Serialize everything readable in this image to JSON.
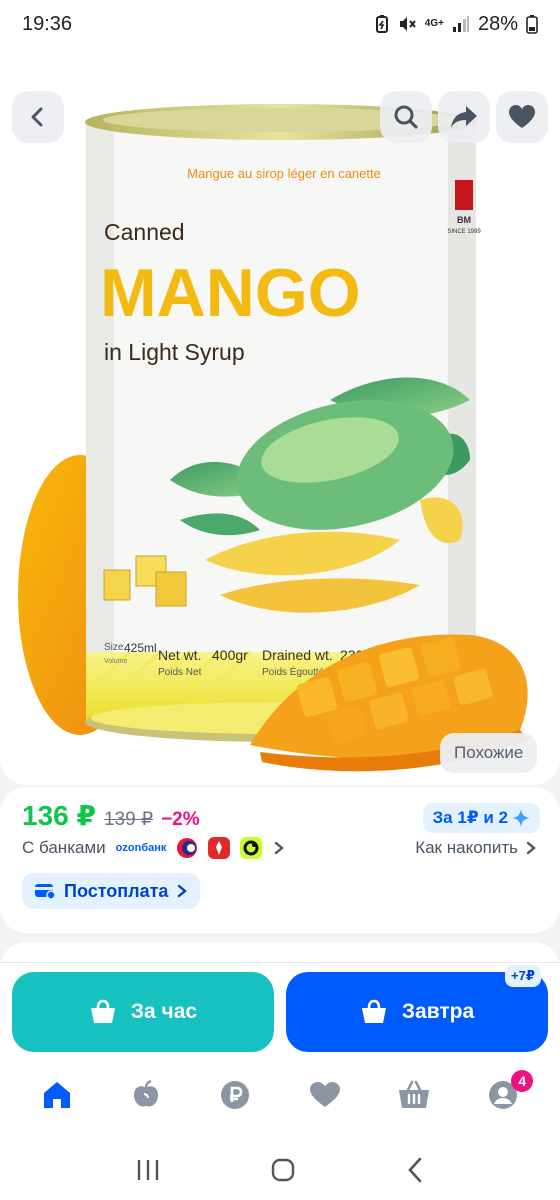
{
  "status_bar": {
    "time": "19:36",
    "network": "4G+",
    "battery": "28%"
  },
  "product_image": {
    "tagline": "Mangue au sirop léger en canette",
    "canned": "Canned",
    "mango": "MANGO",
    "syrup": "in Light Syrup",
    "size_label": "Size",
    "size_value": "425ml",
    "volume": "Volume",
    "net_label": "Net wt.",
    "net_value": "400gr",
    "net_sub": "Poids Net",
    "drained_label": "Drained wt.",
    "drained_value": "230gr",
    "drained_sub": "Poids Égoutté",
    "brand_short": "BM",
    "brand_since": "SINCE 1999"
  },
  "gallery": {
    "similar_label": "Похожие"
  },
  "price": {
    "current": "136 ₽",
    "old": "139 ₽",
    "discount": "−2%"
  },
  "points": {
    "label": "За 1₽ и 2"
  },
  "banks": {
    "label": "С банками",
    "ozon_line1": "ozon",
    "ozon_line2": "банк"
  },
  "accumulate": {
    "label": "Как накопить"
  },
  "postpay": {
    "label": "Постоплата"
  },
  "actions": {
    "hour_label": "За час",
    "tomorrow_label": "Завтра",
    "extra_price": "+7₽"
  },
  "tabs": {
    "cart_count": "4"
  },
  "colors": {
    "ozon_blue": "#005bff",
    "price_green": "#10c44c",
    "discount_pink": "#f1117e",
    "express_teal": "#17c1c0"
  },
  "icons": [
    "back-icon",
    "search-icon",
    "share-icon",
    "heart-icon",
    "home-icon",
    "fresh-icon",
    "ruble-icon",
    "favorites-icon",
    "cart-icon",
    "profile-icon"
  ]
}
